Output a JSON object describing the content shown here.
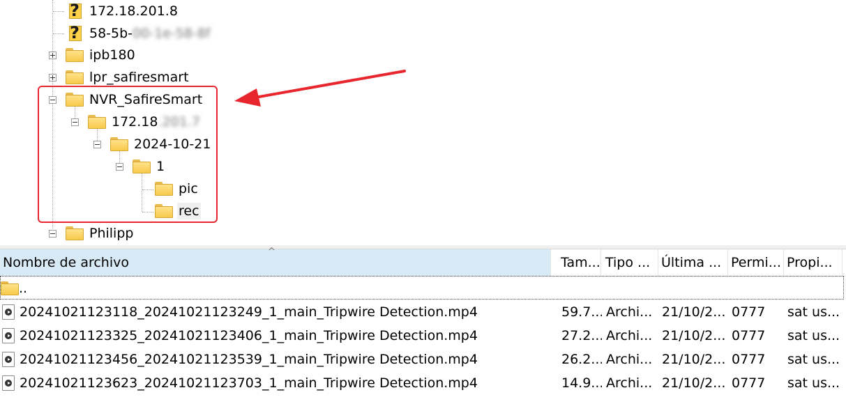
{
  "tree": {
    "items": [
      {
        "label": "172.18.201.8",
        "icon": "question-icon"
      },
      {
        "label": "58-5b-",
        "blurred": "00-1e-58-8f",
        "icon": "question-icon"
      },
      {
        "label": "ipb180",
        "icon": "folder-icon",
        "expander": "plus"
      },
      {
        "label": "lpr_safiresmart",
        "icon": "folder-icon",
        "expander": "plus"
      },
      {
        "label": "NVR_SafireSmart",
        "icon": "folder-icon",
        "expander": "minus"
      },
      {
        "label": "172.18",
        "blurred": ".201.7",
        "icon": "folder-icon",
        "expander": "minus"
      },
      {
        "label": "2024-10-21",
        "icon": "folder-icon",
        "expander": "minus"
      },
      {
        "label": "1",
        "icon": "folder-icon",
        "expander": "minus"
      },
      {
        "label": "pic",
        "icon": "folder-icon"
      },
      {
        "label": "rec",
        "icon": "folder-icon",
        "selected": true
      },
      {
        "label": "Philipp",
        "icon": "folder-icon",
        "expander": "minus"
      }
    ]
  },
  "annotation": {
    "box_color": "#e8262e",
    "arrow_color": "#e8262e"
  },
  "file_list": {
    "columns": [
      "Nombre de archivo",
      "Tam...",
      "Tipo ...",
      "Última ...",
      "Permi...",
      "Propi..."
    ],
    "parent_row": "..",
    "rows": [
      {
        "name": "20241021123118_20241021123249_1_main_Tripwire Detection.mp4",
        "size": "59.7...",
        "type": "Archi...",
        "modified": "21/10/2...",
        "perms": "0777",
        "owner": "sat us..."
      },
      {
        "name": "20241021123325_20241021123406_1_main_Tripwire Detection.mp4",
        "size": "27.2...",
        "type": "Archi...",
        "modified": "21/10/2...",
        "perms": "0777",
        "owner": "sat us..."
      },
      {
        "name": "20241021123456_20241021123539_1_main_Tripwire Detection.mp4",
        "size": "26.2...",
        "type": "Archi...",
        "modified": "21/10/2...",
        "perms": "0777",
        "owner": "sat us..."
      },
      {
        "name": "20241021123623_20241021123703_1_main_Tripwire Detection.mp4",
        "size": "14.9...",
        "type": "Archi...",
        "modified": "21/10/2...",
        "perms": "0777",
        "owner": "sat us..."
      }
    ]
  }
}
